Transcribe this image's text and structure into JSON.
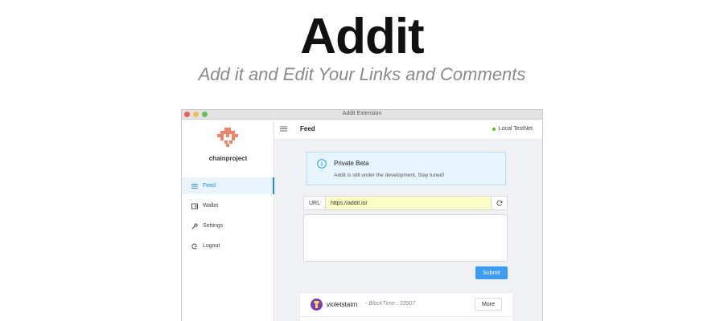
{
  "hero": {
    "title": "Addit",
    "subtitle": "Add it and Edit Your Links and Comments"
  },
  "window": {
    "title": "Addit Extension"
  },
  "sidebar": {
    "project_name": "chainproject",
    "items": [
      {
        "label": "Feed",
        "icon": "list-icon",
        "active": true
      },
      {
        "label": "Wallet",
        "icon": "wallet-icon",
        "active": false
      },
      {
        "label": "Settings",
        "icon": "wrench-icon",
        "active": false
      },
      {
        "label": "Logout",
        "icon": "logout-icon",
        "active": false
      }
    ]
  },
  "header": {
    "title": "Feed",
    "network": "Local TestNet"
  },
  "alert": {
    "title": "Private Beta",
    "body": "Addit is still under the development. Stay tuned!"
  },
  "form": {
    "url_label": "URL",
    "url_value": "https://addit.io/",
    "comment_placeholder": "",
    "submit_label": "Submit"
  },
  "feed": {
    "items": [
      {
        "author": "violetstairn",
        "blocktime": "- BlockTime : 33907",
        "more_label": "More"
      }
    ]
  },
  "colors": {
    "accent": "#1a8cff",
    "submit": "#3d9bf5",
    "logo": "#ee8566",
    "avatar": "#7b3fb8",
    "status": "#52c41a",
    "url_highlight": "#fdfdc6"
  }
}
